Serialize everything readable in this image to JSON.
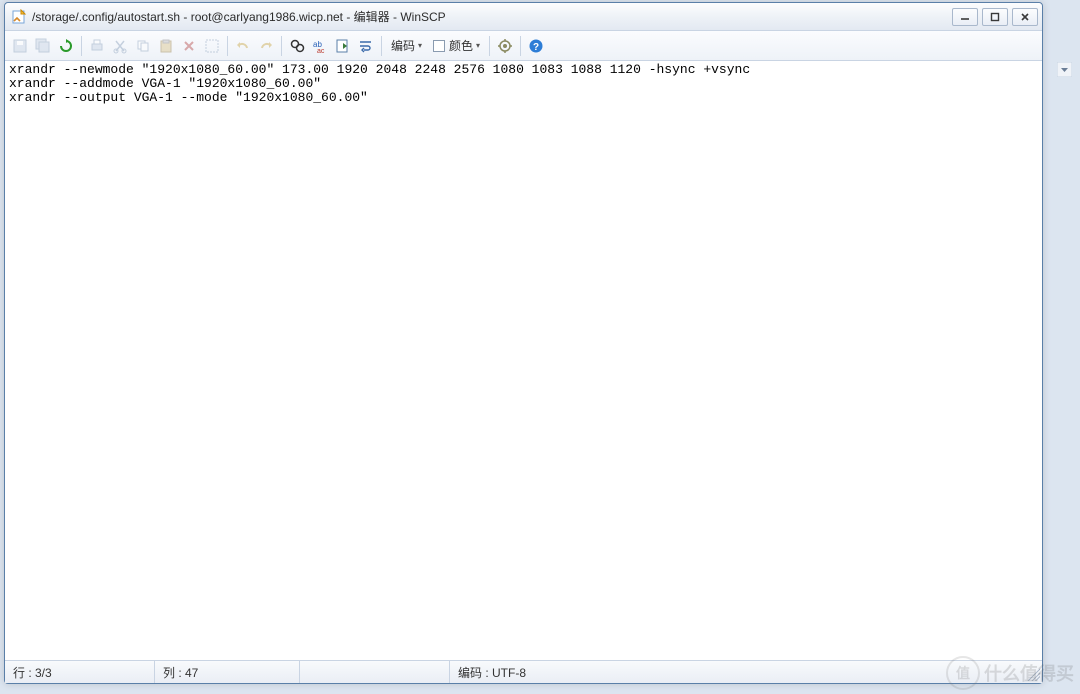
{
  "window": {
    "title": "/storage/.config/autostart.sh - root@carlyang1986.wicp.net - 编辑器 - WinSCP"
  },
  "toolbar": {
    "encoding_label": "编码",
    "color_label": "颜色"
  },
  "editor": {
    "content": "xrandr --newmode \"1920x1080_60.00\" 173.00 1920 2048 2248 2576 1080 1083 1088 1120 -hsync +vsync\nxrandr --addmode VGA-1 \"1920x1080_60.00\"\nxrandr --output VGA-1 --mode \"1920x1080_60.00\""
  },
  "status": {
    "line": "行 : 3/3",
    "column": "列 : 47",
    "charset": "编码 : UTF-8"
  },
  "watermark": {
    "badge": "值",
    "text": "什么值得买"
  }
}
